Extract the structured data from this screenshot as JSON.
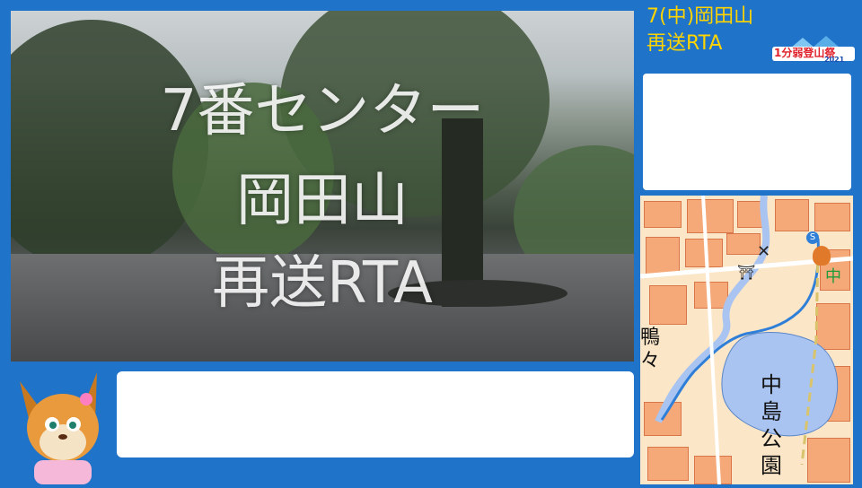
{
  "stream_title": {
    "line1": "7(中)岡田山",
    "line2": "再送RTA"
  },
  "event_logo": {
    "text": "1分弱登山祭",
    "year": "2021"
  },
  "video_overlay": {
    "line1": "7番センター",
    "line2": "岡田山",
    "line3": "再送RTA"
  },
  "map": {
    "label_park": [
      "中",
      "島",
      "公",
      "園"
    ],
    "label_side": [
      "鴨",
      "々"
    ],
    "label_area": "中",
    "icon_names": [
      "shrine-icon",
      "station-icon",
      "mascot-marker-icon",
      "x-marker-icon"
    ]
  },
  "colors": {
    "background": "#1f73c8",
    "title_text": "#ffd400",
    "map_water": "#a9c4f0",
    "map_route": "#2f7fd8"
  }
}
